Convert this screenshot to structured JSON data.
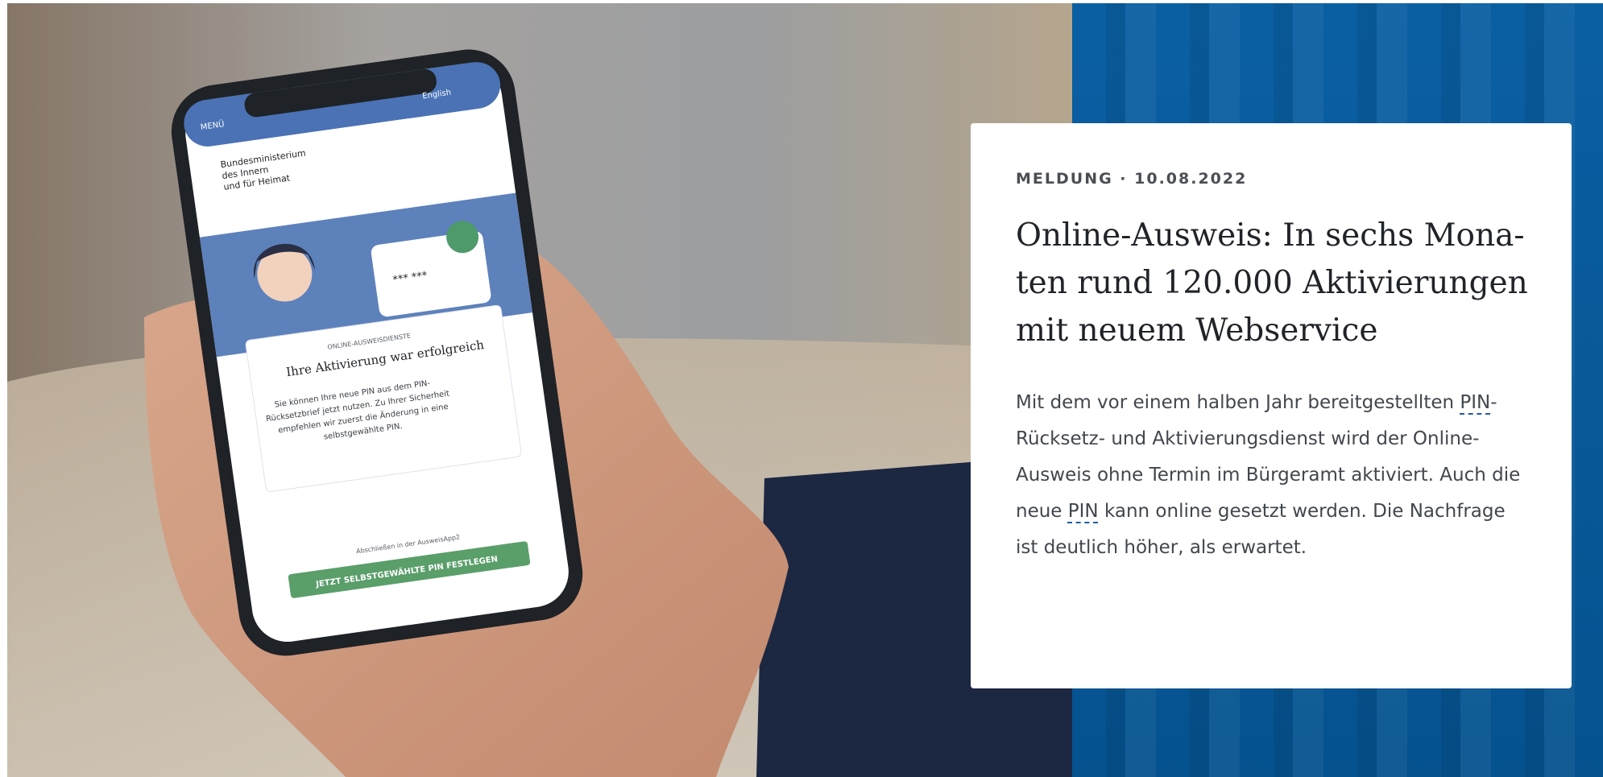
{
  "hero": {
    "phone_screen": {
      "menu_label": "MENÜ",
      "language_label": "English",
      "ministry_lines": [
        "Bundesministerium",
        "des Innern",
        "und für Heimat"
      ],
      "pin_mask": "*** ***",
      "service_label": "ONLINE-AUSWEISDIENSTE",
      "heading": "Ihre Aktivierung war erfolgreich",
      "body_lines": [
        "Sie können Ihre neue PIN aus dem PIN-",
        "Rücksetzbrief jetzt nutzen. Zu Ihrer Sicherheit",
        "empfehlen wir zuerst die Änderung in eine",
        "selbstgewählte PIN."
      ],
      "footnote": "Abschließen in der AusweisApp2",
      "cta": "JETZT SELBSTGEWÄHLTE PIN FESTLEGEN"
    }
  },
  "card": {
    "meta": "MELDUNG · 10.08.2022",
    "title_lines": [
      "Online-Ausweis: In sechs Mona-",
      "ten rund 120.000 Aktivierungen",
      "mit neuem Webservice"
    ],
    "teaser_parts": [
      "Mit dem vor einem halben Jahr bereitgestellten ",
      "PIN",
      "-Rücksetz- und Aktivierungsdienst wird der Online-Ausweis ohne Termin im Bürgeramt aktiviert. Auch die neue ",
      "PIN",
      " kann online gesetzt werden. Die Nachfrage ist deutlich höher, als erwartet."
    ]
  },
  "colors": {
    "blue_panel": "#05528f",
    "phone_header": "#4a72b5",
    "cta_green": "#5a9e6a",
    "card_bg": "#ffffff",
    "abbr_underline": "#1f5ba3"
  }
}
